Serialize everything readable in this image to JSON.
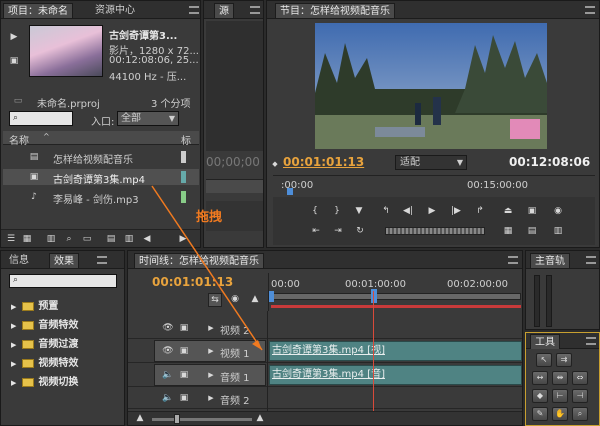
{
  "project": {
    "tab_project": "项目：未命名",
    "tab_resource": "资源中心",
    "clip_title": "古剑奇谭第3...",
    "clip_info1": "影片，1280 x 72...",
    "clip_info2": "00:12:08:06, 25...",
    "clip_info3": "44100 Hz - 压...",
    "file_name": "未命名.prproj",
    "item_count": "3 个分项",
    "entry_label": "入口:",
    "entry_value": "全部",
    "col_name": "名称",
    "col_tag": "标",
    "items": [
      "怎样给视频配音乐",
      "古剑奇谭第3集.mp4",
      "李易峰 - 剑伤.mp3"
    ]
  },
  "source": {
    "tab": "源",
    "timecode": "00;00;00",
    "timecode2": "00;00;00"
  },
  "program": {
    "tab": "节目：怎样给视频配音乐",
    "timecode_left": "00:01:01:13",
    "fit": "适配",
    "timecode_right": "00:12:08:06",
    "ruler_start": ":00:00",
    "ruler_mid": "00:15:00:00"
  },
  "effects": {
    "tab_info": "信息",
    "tab_effects": "效果",
    "folders": [
      "预置",
      "音频特效",
      "音频过渡",
      "视频特效",
      "视频切换"
    ]
  },
  "annotation": "拖拽",
  "timeline": {
    "tab": "时间线：怎样给视频配音乐",
    "timecode": "00:01:01:13",
    "ruler": [
      "00:00",
      "00:01:00:00",
      "00:02:00:00"
    ],
    "tracks": [
      "视频 2",
      "视频 1",
      "音频 1",
      "音频 2"
    ],
    "video_clip": "古剑奇谭第3集.mp4 [视]",
    "audio_clip": "古剑奇谭第3集.mp4 [音]"
  },
  "master": {
    "tab": "主音轨"
  },
  "tools": {
    "tab": "工具"
  }
}
